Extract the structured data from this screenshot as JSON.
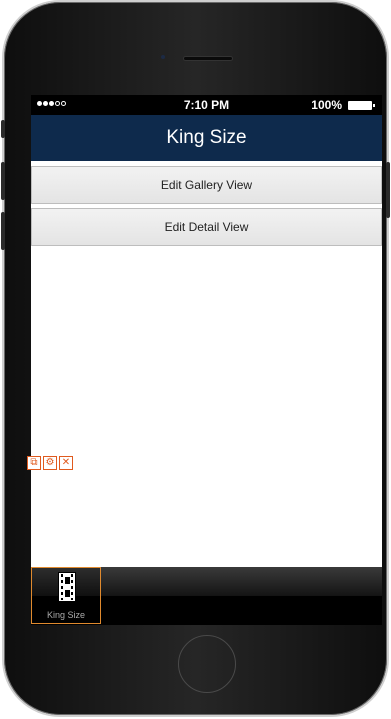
{
  "status_bar": {
    "signal": "●●●○○",
    "time": "7:10 PM",
    "battery_percent": "100%"
  },
  "nav": {
    "title": "King Size"
  },
  "menu": [
    {
      "label": "Edit Gallery View"
    },
    {
      "label": "Edit Detail View"
    }
  ],
  "tab_bar": {
    "items": [
      {
        "label": "King Size",
        "icon": "film-icon"
      }
    ]
  },
  "toolbar_icons": [
    "copy-icon",
    "settings-icon",
    "delete-icon"
  ],
  "colors": {
    "nav_bg": "#0e2a4c",
    "selection": "#e08a2e",
    "tool": "#e05a1e"
  }
}
